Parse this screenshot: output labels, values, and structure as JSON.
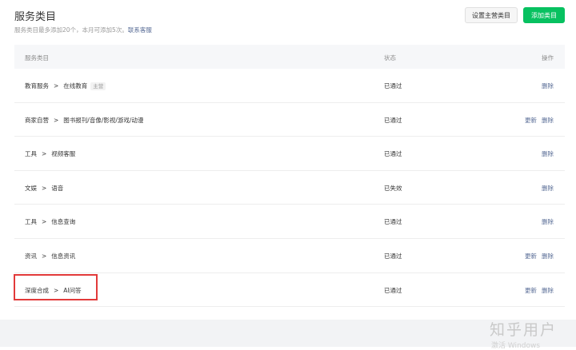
{
  "header": {
    "title": "服务类目",
    "subtitle_prefix": "服务类目最多添加20个，本月可添加5次。",
    "subtitle_link": "联系客服",
    "set_primary_button": "设置主营类目",
    "add_button": "添加类目"
  },
  "table": {
    "columns": [
      "服务类目",
      "状态",
      "操作"
    ],
    "separator": ">",
    "rows": [
      {
        "parent": "教育服务",
        "child": "在线教育",
        "tag": "主营",
        "status": "已通过",
        "ops": [
          "删除"
        ]
      },
      {
        "parent": "商家自营",
        "child": "图书报刊/音像/影视/游戏/动漫",
        "tag": "",
        "status": "已通过",
        "ops": [
          "更新",
          "删除"
        ]
      },
      {
        "parent": "工具",
        "child": "视频客服",
        "tag": "",
        "status": "已通过",
        "ops": [
          "删除"
        ]
      },
      {
        "parent": "文娱",
        "child": "语音",
        "tag": "",
        "status": "已失效",
        "ops": [
          "删除"
        ]
      },
      {
        "parent": "工具",
        "child": "信息查询",
        "tag": "",
        "status": "已通过",
        "ops": [
          "删除"
        ]
      },
      {
        "parent": "资讯",
        "child": "信息资讯",
        "tag": "",
        "status": "已通过",
        "ops": [
          "更新",
          "删除"
        ]
      },
      {
        "parent": "深度合成",
        "child": "AI问答",
        "tag": "",
        "status": "已通过",
        "ops": [
          "更新",
          "删除"
        ]
      }
    ]
  },
  "watermark": "知乎用户",
  "windows_mark": "激活 Windows",
  "colors": {
    "primary": "#07c160",
    "link": "#576b95",
    "highlight": "#e23a3a"
  }
}
